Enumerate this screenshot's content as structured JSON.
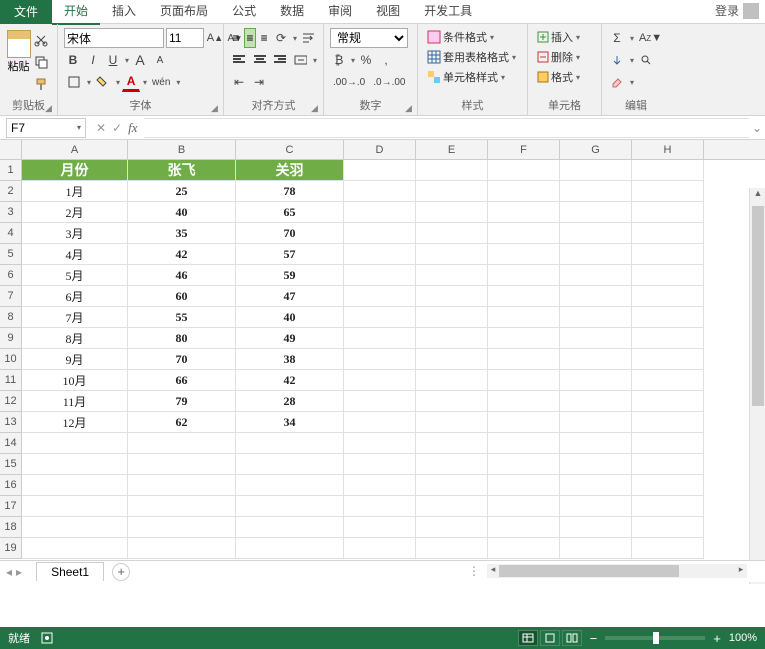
{
  "menu": {
    "file": "文件",
    "tabs": [
      "开始",
      "插入",
      "页面布局",
      "公式",
      "数据",
      "审阅",
      "视图",
      "开发工具"
    ],
    "login": "登录"
  },
  "ribbon": {
    "clipboard": {
      "paste": "粘贴",
      "label": "剪贴板"
    },
    "font": {
      "name": "宋体",
      "size": "11",
      "label": "字体",
      "bold": "B",
      "italic": "I",
      "underline": "U",
      "wen": "wén"
    },
    "align": {
      "label": "对齐方式"
    },
    "number": {
      "format": "常规",
      "label": "数字",
      "pct": "%"
    },
    "styles": {
      "cond": "条件格式",
      "tbl": "套用表格格式",
      "cell": "单元格样式",
      "label": "样式"
    },
    "cells": {
      "ins": "插入",
      "del": "删除",
      "fmt": "格式",
      "label": "单元格"
    },
    "editing": {
      "label": "编辑"
    }
  },
  "namebox": "F7",
  "fx": "fx",
  "columns": [
    "A",
    "B",
    "C",
    "D",
    "E",
    "F",
    "G",
    "H"
  ],
  "header_row": [
    "月份",
    "张飞",
    "关羽"
  ],
  "data_rows": [
    [
      "1月",
      "25",
      "78"
    ],
    [
      "2月",
      "40",
      "65"
    ],
    [
      "3月",
      "35",
      "70"
    ],
    [
      "4月",
      "42",
      "57"
    ],
    [
      "5月",
      "46",
      "59"
    ],
    [
      "6月",
      "60",
      "47"
    ],
    [
      "7月",
      "55",
      "40"
    ],
    [
      "8月",
      "80",
      "49"
    ],
    [
      "9月",
      "70",
      "38"
    ],
    [
      "10月",
      "66",
      "42"
    ],
    [
      "11月",
      "79",
      "28"
    ],
    [
      "12月",
      "62",
      "34"
    ]
  ],
  "total_rows": 19,
  "sheet": {
    "name": "Sheet1"
  },
  "status": {
    "ready": "就绪",
    "zoom": "100%"
  },
  "chart_data": {
    "type": "table",
    "title": "",
    "columns": [
      "月份",
      "张飞",
      "关羽"
    ],
    "series": [
      {
        "name": "张飞",
        "values": [
          25,
          40,
          35,
          42,
          46,
          60,
          55,
          80,
          70,
          66,
          79,
          62
        ]
      },
      {
        "name": "关羽",
        "values": [
          78,
          65,
          70,
          57,
          59,
          47,
          40,
          49,
          38,
          42,
          28,
          34
        ]
      }
    ],
    "categories": [
      "1月",
      "2月",
      "3月",
      "4月",
      "5月",
      "6月",
      "7月",
      "8月",
      "9月",
      "10月",
      "11月",
      "12月"
    ]
  }
}
